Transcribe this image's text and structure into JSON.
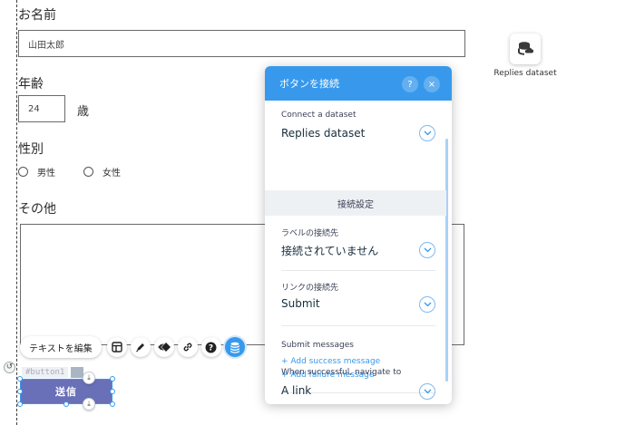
{
  "form": {
    "name_label": "お名前",
    "name_value": "山田太郎",
    "age_label": "年齢",
    "age_value": "24",
    "age_unit": "歳",
    "gender_label": "性別",
    "gender_male": "男性",
    "gender_female": "女性",
    "other_label": "その他",
    "submit_label": "送信"
  },
  "selection": {
    "component_id": "#button1"
  },
  "toolbar": {
    "edit_text_label": "テキストを編集",
    "icons": [
      "layout-icon",
      "pen-icon",
      "animation-icon",
      "link-icon",
      "help-icon",
      "database-icon"
    ]
  },
  "dataset": {
    "label": "Replies dataset"
  },
  "panel": {
    "title": "ボタンを接続",
    "help_glyph": "?",
    "close_glyph": "×",
    "connect_dataset_label": "Connect a dataset",
    "connect_dataset_value": "Replies dataset",
    "connection_settings_title": "接続設定",
    "label_connects_to_label": "ラベルの接続先",
    "label_connects_to_value": "接続されていません",
    "link_connects_to_label": "リンクの接続先",
    "link_connects_to_value": "Submit",
    "submit_messages_label": "Submit messages",
    "add_success_message": "+ Add success message",
    "add_failure_message": "+ Add failure message",
    "navigate_label": "When successful, navigate to",
    "navigate_value": "A link"
  },
  "colors": {
    "accent": "#3899ec",
    "submit_button": "#6970b8",
    "section_bar": "#eef1f4"
  }
}
